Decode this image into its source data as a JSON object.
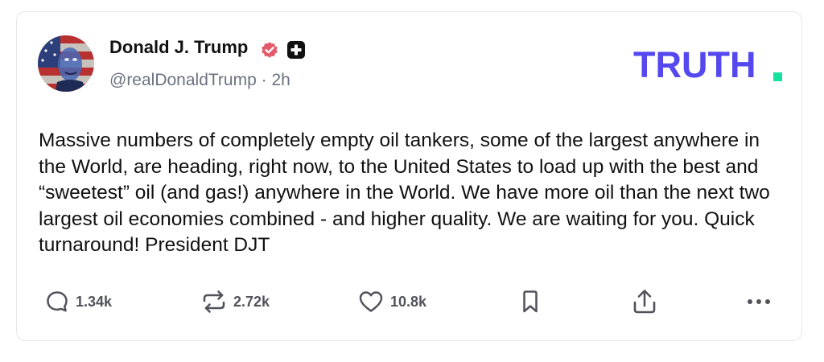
{
  "post": {
    "author": {
      "display_name": "Donald J. Trump",
      "handle_line": "@realDonaldTrump · 2h"
    },
    "brand": {
      "logo_text": "TRUTH",
      "primary_color": "#5448ee",
      "dot_color": "#17e3a1"
    },
    "badges": {
      "verified_color": "#e45a6b",
      "plus_color": "#111111"
    },
    "text": "Massive numbers of completely empty oil tankers, some of the largest anywhere in the World, are heading, right now, to the United States to load up with the best and “sweetest” oil (and gas!) anywhere in the World. We have more oil than the next two largest oil economies combined - and higher quality. We are waiting for you. Quick turnaround! President DJT",
    "actions": {
      "reply": {
        "icon": "comment-icon",
        "count": "1.34k"
      },
      "retruth": {
        "icon": "repost-icon",
        "count": "2.72k"
      },
      "like": {
        "icon": "heart-icon",
        "count": "10.8k"
      },
      "bookmark": {
        "icon": "bookmark-icon"
      },
      "share": {
        "icon": "share-icon"
      },
      "more": {
        "icon": "more-icon"
      }
    }
  }
}
